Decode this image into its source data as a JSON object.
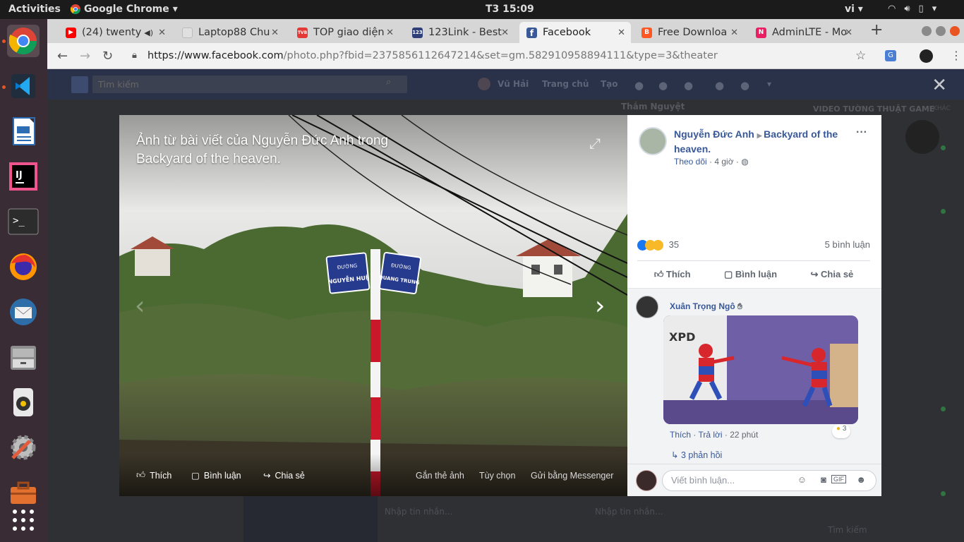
{
  "os": {
    "activities": "Activities",
    "app_name": "Google Chrome",
    "clock": "T3 15:09",
    "lang": "vi"
  },
  "tabs": [
    {
      "title": "(24) twenty",
      "fav": "youtube",
      "color": "#ff0000"
    },
    {
      "title": "Laptop88 Chu",
      "fav": "page",
      "color": "#bdbdbd"
    },
    {
      "title": "TOP giao diện",
      "fav": "tvb",
      "color": "#e53935"
    },
    {
      "title": "123Link - Best",
      "fav": "123",
      "color": "#2e3f7a"
    },
    {
      "title": "Facebook",
      "fav": "facebook",
      "color": "#3b5998"
    },
    {
      "title": "Free Downloa",
      "fav": "blogger",
      "color": "#ff5722"
    },
    {
      "title": "AdminLTE - Mo",
      "fav": "adminlte",
      "color": "#e91e63"
    }
  ],
  "omnibox": {
    "url_host": "https://www.facebook.com",
    "url_path": "/photo.php?fbid=2375856112647214&set=gm.582910958894111&type=3&theater"
  },
  "fb": {
    "search_placeholder": "Tìm kiếm",
    "user": "Vũ Hải",
    "home": "Trang chủ",
    "create": "Tạo",
    "right_header": "VIDEO TƯỜNG THUẬT GAME",
    "right_header2": "KHÁC",
    "bg_name": "Thắm Nguyệt",
    "chat_placeholder": "Nhập tin nhắn...",
    "chat_search": "Tìm kiếm"
  },
  "photo": {
    "caption": "Ảnh từ bài viết của Nguyễn Đức Anh trong Backyard of the heaven.",
    "sign_label": "ĐƯỜNG",
    "sign1": "NGUYỄN HUỆ",
    "sign2": "QUANG TRUNG",
    "actions": {
      "like": "Thích",
      "comment": "Bình luận",
      "share": "Chia sẻ",
      "tag": "Gắn thẻ ảnh",
      "options": "Tùy chọn",
      "send": "Gửi bằng Messenger"
    }
  },
  "post": {
    "author": "Nguyễn Đức Anh",
    "group": "Backyard of the heaven.",
    "follow": "Theo dõi",
    "time": "4 giờ",
    "reaction_count": "35",
    "comment_count": "5 bình luận",
    "like": "Thích",
    "comment": "Bình luận",
    "share": "Chia sẻ"
  },
  "comment": {
    "author": "Xuân Trọng Ngô",
    "gif_text": "XPD",
    "like": "Thích",
    "reply": "Trả lời",
    "time": "22 phút",
    "reaction_count": "3",
    "replies": "3 phản hồi",
    "composer_placeholder": "Viết bình luận..."
  }
}
